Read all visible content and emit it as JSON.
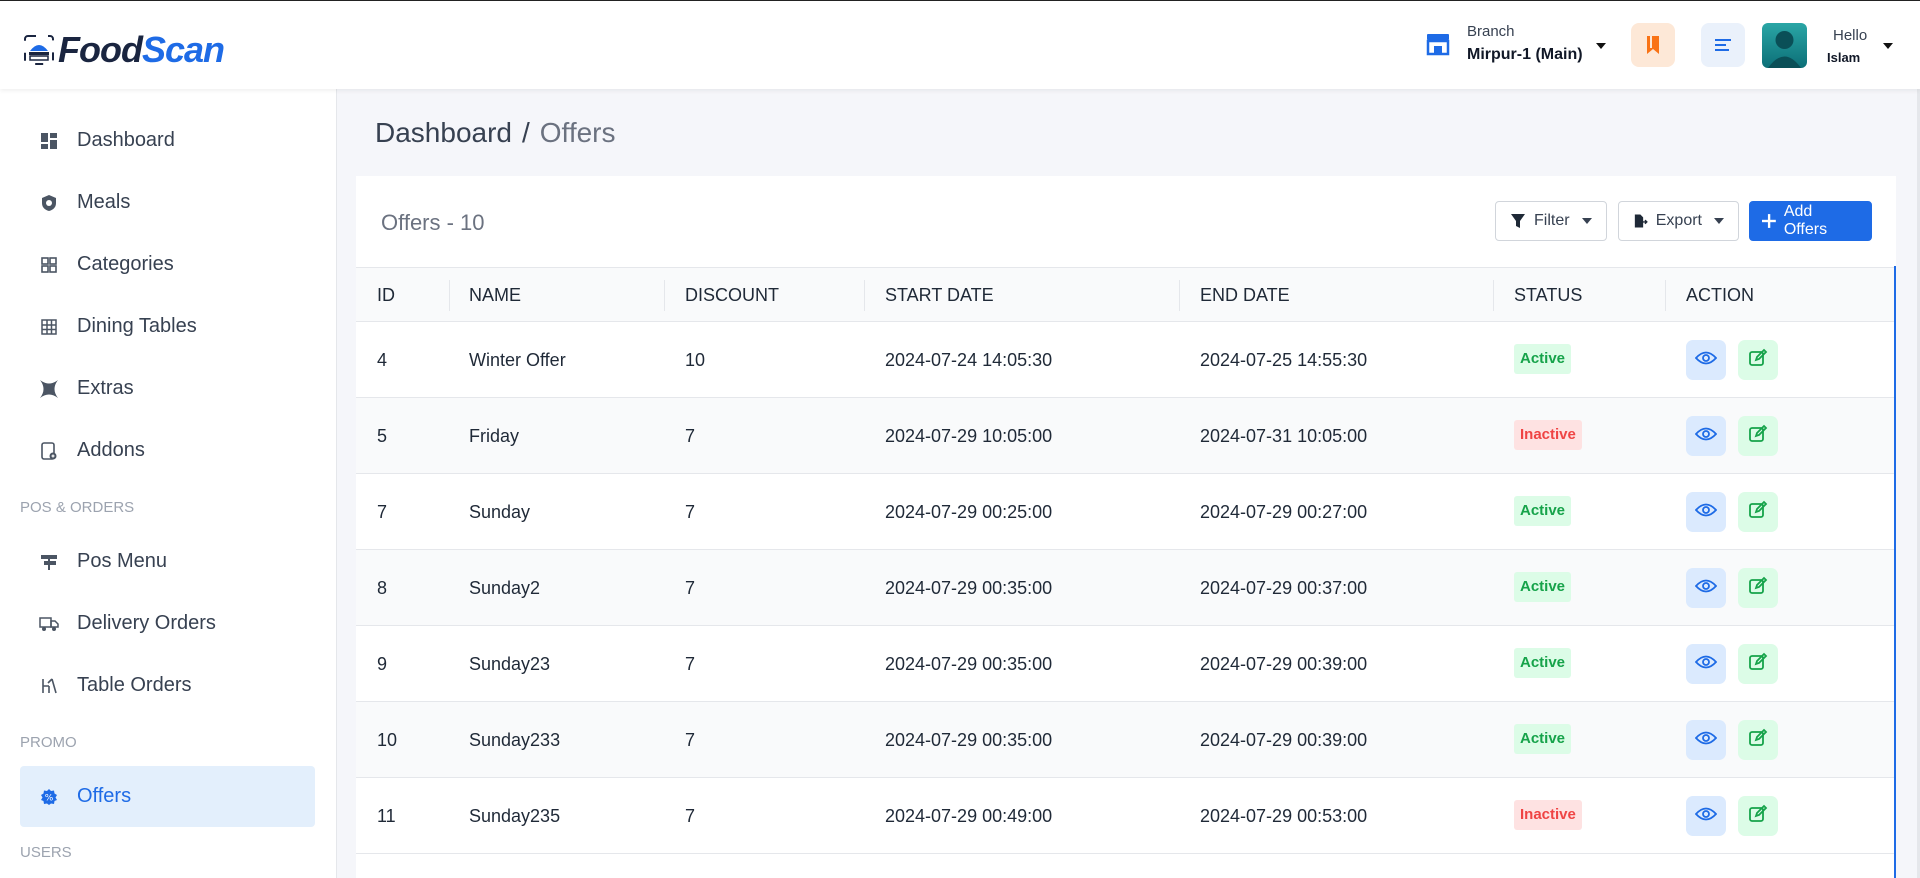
{
  "header": {
    "logo_part1": "Food",
    "logo_part2": "Scan",
    "branch_label": "Branch",
    "branch_value": "Mirpur-1 (Main)",
    "user_greeting": "Hello",
    "user_name": "Islam"
  },
  "sidebar": {
    "items": [
      {
        "label": "Dashboard",
        "icon": "dashboard-icon"
      },
      {
        "label": "Meals",
        "icon": "meals-icon"
      },
      {
        "label": "Categories",
        "icon": "categories-icon"
      },
      {
        "label": "Dining Tables",
        "icon": "dining-tables-icon"
      },
      {
        "label": "Extras",
        "icon": "extras-icon"
      },
      {
        "label": "Addons",
        "icon": "addons-icon"
      }
    ],
    "section_pos": "POS & ORDERS",
    "pos_items": [
      {
        "label": "Pos Menu",
        "icon": "pos-menu-icon"
      },
      {
        "label": "Delivery Orders",
        "icon": "delivery-icon"
      },
      {
        "label": "Table Orders",
        "icon": "table-orders-icon"
      }
    ],
    "section_promo": "PROMO",
    "promo_items": [
      {
        "label": "Offers",
        "icon": "offers-icon",
        "active": true
      }
    ],
    "section_users": "USERS"
  },
  "breadcrumb": {
    "root": "Dashboard",
    "separator": "/",
    "current": "Offers"
  },
  "card": {
    "title": "Offers - 10",
    "filter_label": "Filter",
    "export_label": "Export",
    "add_label": "Add Offers"
  },
  "table": {
    "columns": [
      "ID",
      "NAME",
      "DISCOUNT",
      "START DATE",
      "END DATE",
      "STATUS",
      "ACTION"
    ],
    "rows": [
      {
        "id": "4",
        "name": "Winter Offer",
        "discount": "10",
        "start": "2024-07-24 14:05:30",
        "end": "2024-07-25 14:55:30",
        "status": "Active"
      },
      {
        "id": "5",
        "name": "Friday",
        "discount": "7",
        "start": "2024-07-29 10:05:00",
        "end": "2024-07-31 10:05:00",
        "status": "Inactive"
      },
      {
        "id": "7",
        "name": "Sunday",
        "discount": "7",
        "start": "2024-07-29 00:25:00",
        "end": "2024-07-29 00:27:00",
        "status": "Active"
      },
      {
        "id": "8",
        "name": "Sunday2",
        "discount": "7",
        "start": "2024-07-29 00:35:00",
        "end": "2024-07-29 00:37:00",
        "status": "Active"
      },
      {
        "id": "9",
        "name": "Sunday23",
        "discount": "7",
        "start": "2024-07-29 00:35:00",
        "end": "2024-07-29 00:39:00",
        "status": "Active"
      },
      {
        "id": "10",
        "name": "Sunday233",
        "discount": "7",
        "start": "2024-07-29 00:35:00",
        "end": "2024-07-29 00:39:00",
        "status": "Active"
      },
      {
        "id": "11",
        "name": "Sunday235",
        "discount": "7",
        "start": "2024-07-29 00:49:00",
        "end": "2024-07-29 00:53:00",
        "status": "Inactive"
      }
    ]
  },
  "colors": {
    "accent": "#1e6be6",
    "active_badge": "#16a34a",
    "inactive_badge": "#ef4444"
  }
}
